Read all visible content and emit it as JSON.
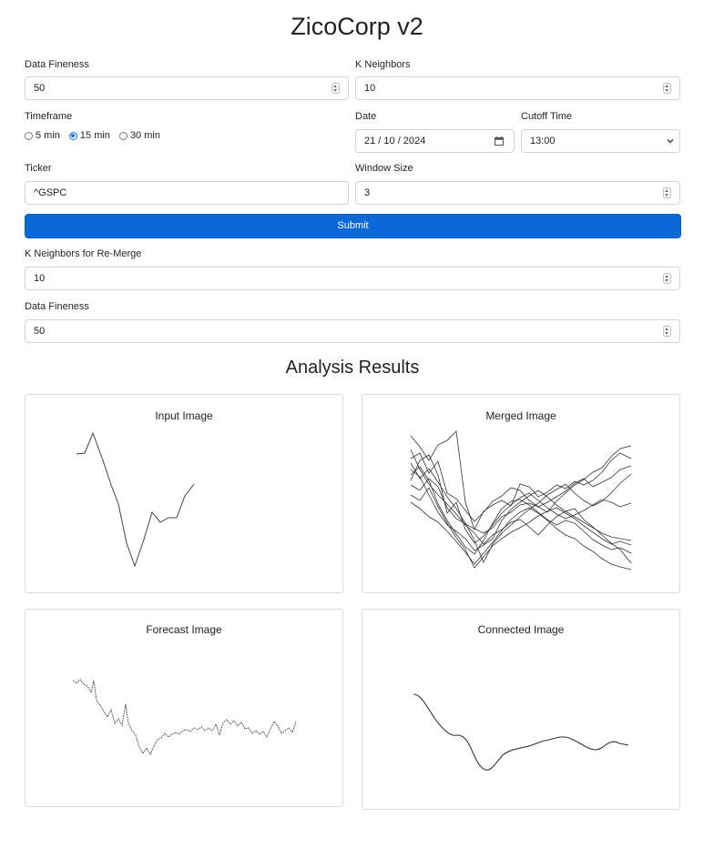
{
  "app": {
    "title": "ZicoCorp v2"
  },
  "form": {
    "data_fineness": {
      "label": "Data Fineness",
      "value": "50"
    },
    "k_neighbors": {
      "label": "K Neighbors",
      "value": "10"
    },
    "timeframe": {
      "label": "Timeframe",
      "options": [
        "5 min",
        "15 min",
        "30 min"
      ],
      "selected": "15 min"
    },
    "date": {
      "label": "Date",
      "value": "21 / 10 / 2024"
    },
    "cutoff_time": {
      "label": "Cutoff Time",
      "value": "13:00"
    },
    "ticker": {
      "label": "Ticker",
      "value": "^GSPC"
    },
    "window_size": {
      "label": "Window Size",
      "value": "3"
    },
    "submit_label": "Submit",
    "k_neighbors_remerge": {
      "label": "K Neighbors for Re-Merge",
      "value": "10"
    },
    "data_fineness_2": {
      "label": "Data Fineness",
      "value": "50"
    }
  },
  "results": {
    "heading": "Analysis Results",
    "cards": [
      {
        "title": "Input Image"
      },
      {
        "title": "Merged Image"
      },
      {
        "title": "Forecast Image"
      },
      {
        "title": "Connected Image"
      }
    ]
  },
  "colors": {
    "primary": "#0a69d7",
    "line": "#333333"
  },
  "icons": {
    "number_spinner": "spinner-icon",
    "date_picker": "calendar-icon",
    "select": "chevron-down-icon"
  }
}
